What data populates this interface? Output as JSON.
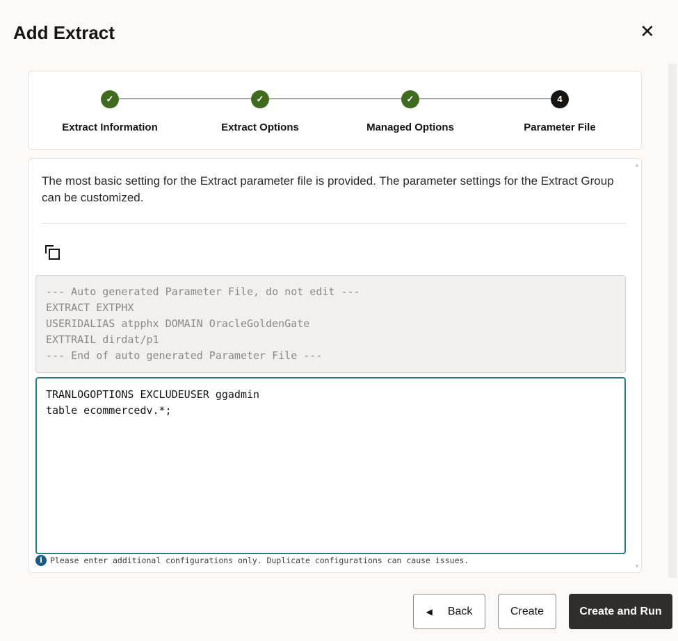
{
  "dialog": {
    "title": "Add Extract",
    "close_icon": "close-icon"
  },
  "steps": [
    {
      "label": "Extract Information",
      "state": "complete",
      "marker": "✓"
    },
    {
      "label": "Extract Options",
      "state": "complete",
      "marker": "✓"
    },
    {
      "label": "Managed Options",
      "state": "complete",
      "marker": "✓"
    },
    {
      "label": "Parameter File",
      "state": "current",
      "marker": "4"
    }
  ],
  "content": {
    "description": "The most basic setting for the Extract parameter file is provided. The parameter settings for the Extract Group can be customized.",
    "readonly_params": "--- Auto generated Parameter File, do not edit ---\nEXTRACT EXTPHX\nUSERIDALIAS atpphx DOMAIN OracleGoldenGate\nEXTTRAIL dirdat/p1\n--- End of auto generated Parameter File ---",
    "editor_value": "TRANLOGOPTIONS EXCLUDEUSER ggadmin\ntable ecommercedv.*;",
    "hint": "Please enter additional configurations only. Duplicate configurations can cause issues."
  },
  "buttons": {
    "back": "Back",
    "create": "Create",
    "create_run": "Create and Run"
  },
  "colors": {
    "complete": "#3e6b1f",
    "primary": "#312d2a",
    "focus": "#2a7a8c"
  }
}
